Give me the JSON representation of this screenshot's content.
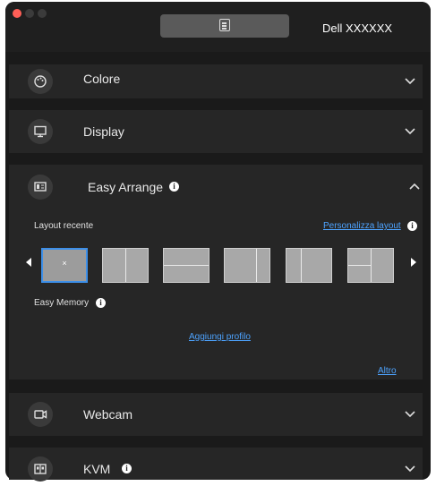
{
  "header": {
    "monitor_name": "Dell XXXXXX",
    "menu_icon": "document-icon"
  },
  "sections": {
    "color": {
      "label": "Colore",
      "icon": "palette-icon"
    },
    "display": {
      "label": "Display",
      "icon": "monitor-icon"
    },
    "easy_arrange": {
      "label": "Easy Arrange",
      "icon": "layout-icon",
      "recent_layout_label": "Layout recente",
      "customize_link": "Personalizza layout",
      "selected_thumb_symbol": "×",
      "layouts": [
        "full",
        "split-2-vertical",
        "split-2-horizontal",
        "split-2-right-narrow",
        "split-2-left-narrow",
        "split-3"
      ],
      "easy_memory_label": "Easy Memory",
      "add_profile_link": "Aggiungi profilo",
      "more_link": "Altro"
    },
    "webcam": {
      "label": "Webcam",
      "icon": "webcam-icon"
    },
    "kvm": {
      "label": "KVM",
      "icon": "kvm-icon"
    }
  },
  "colors": {
    "link": "#4da3ff",
    "selection": "#3d8fe8",
    "panel": "#262626",
    "background": "#1a1a1a"
  }
}
